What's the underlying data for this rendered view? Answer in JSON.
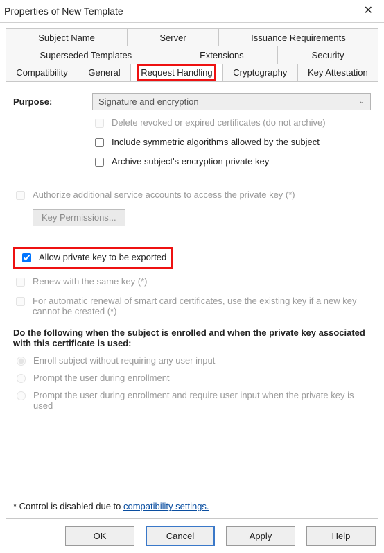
{
  "title": "Properties of New Template",
  "tabs": {
    "row1": [
      "Subject Name",
      "Server",
      "Issuance Requirements"
    ],
    "row2": [
      "Superseded Templates",
      "Extensions",
      "Security"
    ],
    "row3": [
      "Compatibility",
      "General",
      "Request Handling",
      "Cryptography",
      "Key Attestation"
    ]
  },
  "active_tab": "Request Handling",
  "purpose": {
    "label": "Purpose:",
    "value": "Signature and encryption"
  },
  "chk_delete": "Delete revoked or expired certificates (do not archive)",
  "chk_symmetric": "Include symmetric algorithms allowed by the subject",
  "chk_archive": "Archive subject's encryption private key",
  "chk_authorize": "Authorize additional service accounts to access the private key (*)",
  "btn_keyperm": "Key Permissions...",
  "chk_export": "Allow private key to be exported",
  "chk_renew": "Renew with the same key (*)",
  "chk_auto_renew": "For automatic renewal of smart card certificates, use the existing key if a new key cannot be created (*)",
  "heading": "Do the following when the subject is enrolled and when the private key associated with this certificate is used:",
  "rad_enroll": "Enroll subject without requiring any user input",
  "rad_prompt1": "Prompt the user during enrollment",
  "rad_prompt2": "Prompt the user during enrollment and require user input when the private key is used",
  "footnote_prefix": "* Control is disabled due to ",
  "footnote_link": "compatibility settings.",
  "buttons": {
    "ok": "OK",
    "cancel": "Cancel",
    "apply": "Apply",
    "help": "Help"
  }
}
